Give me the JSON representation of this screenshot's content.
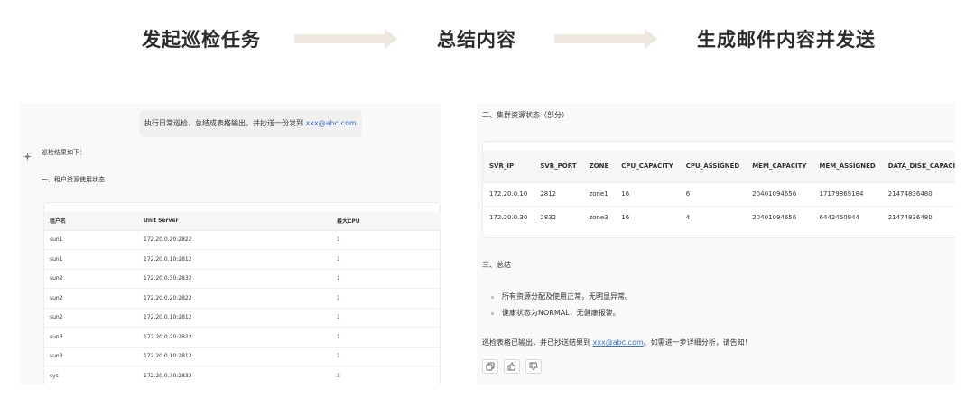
{
  "flow": {
    "steps": [
      "发起巡检任务",
      "总结内容",
      "生成邮件内容并发送"
    ]
  },
  "left": {
    "user_message_prefix": "执行日常巡检，总结成表格输出，并抄送一份发到 ",
    "user_message_email": "xxx@abc.com",
    "result_intro": "巡检结果如下：",
    "section_title": "一、租户资源使用状态",
    "tenant_table": {
      "headers": [
        "租户名",
        "Unit Server",
        "最大CPU"
      ],
      "rows": [
        [
          "sun1",
          "172.20.0.20:2822",
          "1"
        ],
        [
          "sun1",
          "172.20.0.10:2812",
          "1"
        ],
        [
          "sun2",
          "172.20.0.30:2832",
          "1"
        ],
        [
          "sun2",
          "172.20.0.20:2822",
          "1"
        ],
        [
          "sun2",
          "172.20.0.10:2812",
          "1"
        ],
        [
          "sun3",
          "172.20.0.20:2822",
          "1"
        ],
        [
          "sun3",
          "172.20.0.10:2812",
          "1"
        ],
        [
          "sys",
          "172.20.0.30:2832",
          "3"
        ]
      ]
    }
  },
  "right": {
    "section2_title": "二、集群资源状态（部分）",
    "cluster_table": {
      "headers": [
        "SVR_IP",
        "SVR_PORT",
        "ZONE",
        "CPU_CAPACITY",
        "CPU_ASSIGNED",
        "MEM_CAPACITY",
        "MEM_ASSIGNED",
        "DATA_DISK_CAPACITY"
      ],
      "rows": [
        [
          "172.20.0.10",
          "2812",
          "zone1",
          "16",
          "6",
          "20401094656",
          "17179869184",
          "21474836480"
        ],
        [
          "172.20.0.30",
          "2832",
          "zone3",
          "16",
          "4",
          "20401094656",
          "6442450944",
          "21474836480"
        ]
      ]
    },
    "section3_title": "三、总结",
    "bullets": [
      "所有资源分配及使用正常，无明显异常。",
      "健康状态为NORMAL，无健康报警。"
    ],
    "closing_prefix": "巡检表格已输出，并已抄送结果到 ",
    "closing_email": "xxx@abc.com",
    "closing_suffix": "。如需进一步详细分析，请告知！",
    "actions": [
      {
        "name": "copy-icon"
      },
      {
        "name": "thumbs-up-icon"
      },
      {
        "name": "thumbs-down-icon"
      }
    ]
  }
}
